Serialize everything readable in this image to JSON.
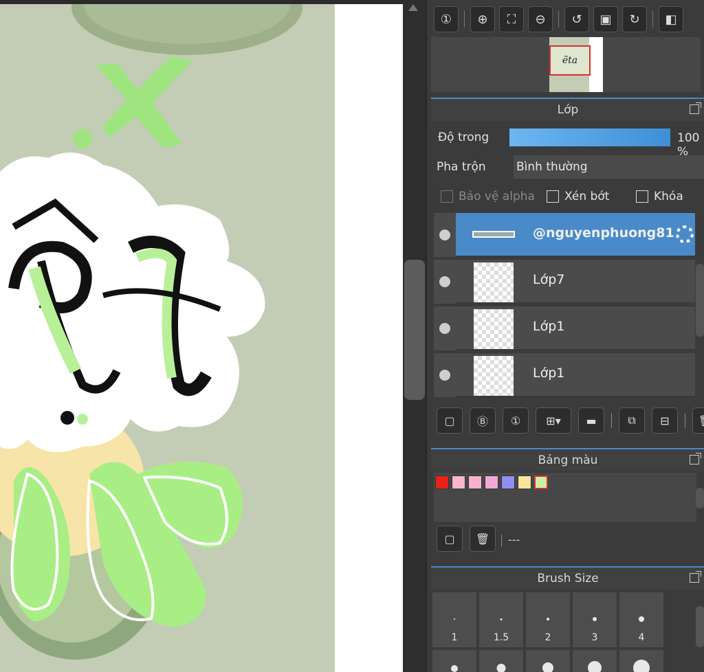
{
  "layer_panel": {
    "title": "Lớp",
    "opacity_label": "Độ trong",
    "opacity_value": "100 %",
    "blend_label": "Pha trộn",
    "blend_value": "Bình thường",
    "protect_alpha": "Bảo vệ alpha",
    "clipping": "Xén bớt",
    "lock": "Khóa",
    "layers": [
      {
        "name": "@nguyenphuong81",
        "selected": true
      },
      {
        "name": "Lớp7",
        "selected": false
      },
      {
        "name": "Lớp1",
        "selected": false
      },
      {
        "name": "Lớp1",
        "selected": false
      }
    ]
  },
  "palette_panel": {
    "title": "Bảng màu",
    "palette_name": "---",
    "swatches": [
      "#e8221b",
      "#f7b6cf",
      "#f7b0d0",
      "#f2a8d8",
      "#8f8ff0",
      "#fbe59c",
      "#c9f0a6"
    ]
  },
  "brush_panel": {
    "title": "Brush Size",
    "sizes": [
      "1",
      "1.5",
      "2",
      "3",
      "4"
    ]
  },
  "navigator": {
    "thumb_text": "ẽta"
  }
}
